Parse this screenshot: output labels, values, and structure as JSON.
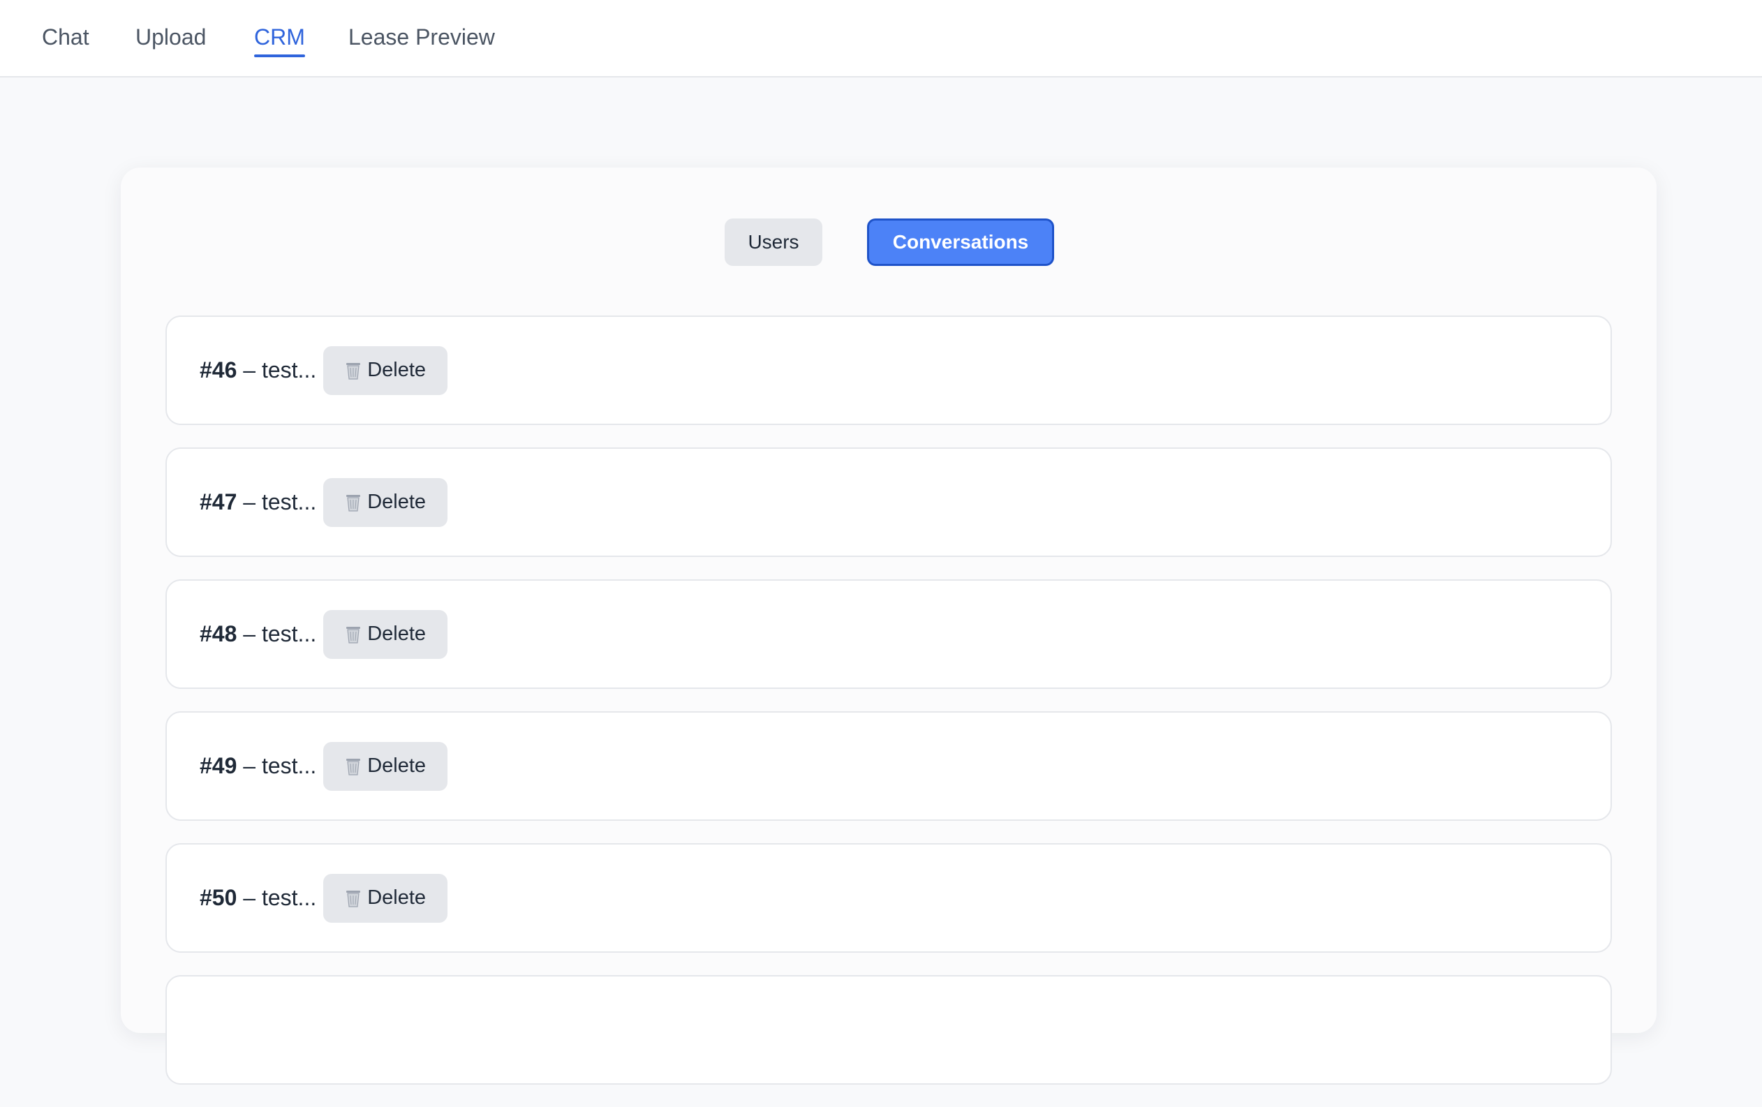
{
  "nav": {
    "tabs": [
      {
        "label": "Chat",
        "active": false
      },
      {
        "label": "Upload",
        "active": false
      },
      {
        "label": "CRM",
        "active": true
      },
      {
        "label": "Lease Preview",
        "active": false
      }
    ]
  },
  "crm": {
    "toggle_users_label": "Users",
    "toggle_conversations_label": "Conversations",
    "active_view": "Conversations"
  },
  "conversations": [
    {
      "id": "#46",
      "preview": " – test...",
      "delete_label": "Delete"
    },
    {
      "id": "#47",
      "preview": " – test...",
      "delete_label": "Delete"
    },
    {
      "id": "#48",
      "preview": " – test...",
      "delete_label": "Delete"
    },
    {
      "id": "#49",
      "preview": " – test...",
      "delete_label": "Delete"
    },
    {
      "id": "#50",
      "preview": " – test...",
      "delete_label": "Delete"
    },
    {
      "id": "",
      "preview": "",
      "delete_label": ""
    }
  ],
  "colors": {
    "accent": "#4c82f7",
    "accent_border": "#1f53c9",
    "nav_active": "#2f64dc",
    "button_gray": "#e5e7eb",
    "background": "#f8f9fb"
  },
  "icons": {
    "delete": "trash-icon"
  }
}
